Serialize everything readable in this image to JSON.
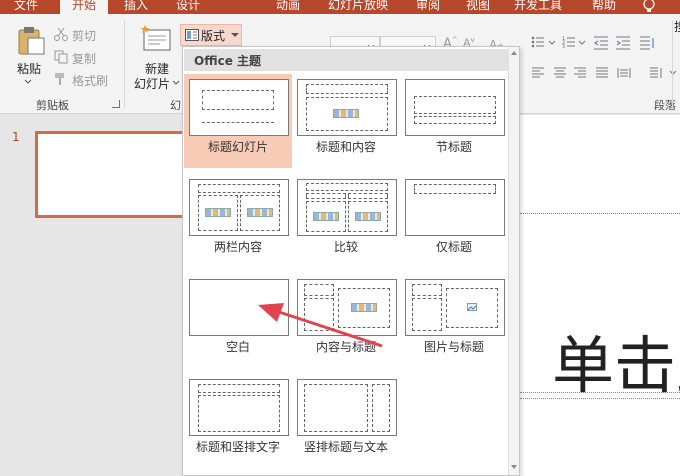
{
  "tabs": [
    {
      "label": "文件",
      "active": false
    },
    {
      "label": "开始",
      "active": true
    },
    {
      "label": "插入",
      "active": false
    },
    {
      "label": "设计",
      "active": false
    },
    {
      "label": "动画",
      "active": false
    },
    {
      "label": "幻灯片放映",
      "active": false
    },
    {
      "label": "审阅",
      "active": false
    },
    {
      "label": "视图",
      "active": false
    },
    {
      "label": "开发工具",
      "active": false
    },
    {
      "label": "帮助",
      "active": false
    }
  ],
  "ribbon": {
    "paste_label": "粘贴",
    "cut_label": "剪切",
    "copy_label": "复制",
    "format_painter_label": "格式刷",
    "clipboard_group": "剪贴板",
    "new_slide_line1": "新建",
    "new_slide_line2": "幻灯片",
    "slides_group": "幻",
    "layout_label": "版式",
    "paragraph_group": "段落",
    "search_partial": "搜"
  },
  "colors": {
    "brand": "#b7472a",
    "selected_item": "#f8cbb7",
    "layout_button_bg": "#f6d8cd",
    "arrow": "#e0454f"
  },
  "dropdown": {
    "section_title": "Office 主题",
    "items": [
      {
        "label": "标题幻灯片",
        "selected": true
      },
      {
        "label": "标题和内容",
        "selected": false
      },
      {
        "label": "节标题",
        "selected": false
      },
      {
        "label": "两栏内容",
        "selected": false
      },
      {
        "label": "比较",
        "selected": false
      },
      {
        "label": "仅标题",
        "selected": false
      },
      {
        "label": "空白",
        "selected": false
      },
      {
        "label": "内容与标题",
        "selected": false
      },
      {
        "label": "图片与标题",
        "selected": false
      },
      {
        "label": "标题和竖排文字",
        "selected": false
      },
      {
        "label": "竖排标题与文本",
        "selected": false
      }
    ]
  },
  "slides": {
    "number": "1"
  },
  "editor": {
    "placeholder_text": "单击此"
  }
}
